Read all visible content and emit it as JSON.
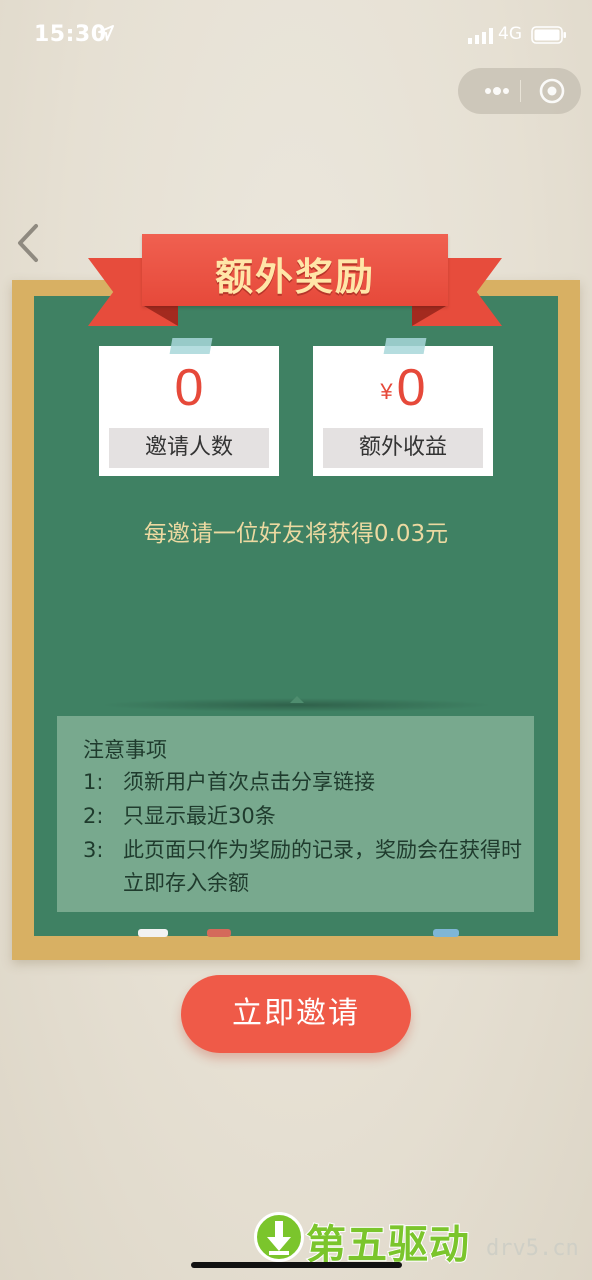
{
  "status_bar": {
    "time": "15:30",
    "network": "4G"
  },
  "banner": {
    "title": "额外奖励"
  },
  "stats": [
    {
      "value": "0",
      "label": "邀请人数"
    },
    {
      "currency": "¥",
      "value": "0",
      "label": "额外收益"
    }
  ],
  "reward_text": "每邀请一位好友将获得0.03元",
  "notes": {
    "title": "注意事项",
    "items": [
      {
        "num": "1:",
        "text": "须新用户首次点击分享链接"
      },
      {
        "num": "2:",
        "text": "只显示最近30条"
      },
      {
        "num": "3:",
        "text": "此页面只作为奖励的记录，奖励会在获得时立即存入余额"
      }
    ]
  },
  "invite_button": {
    "label": "立即邀请"
  },
  "watermark": {
    "brand": "第五驱动",
    "url": "drv5.cn"
  },
  "colors": {
    "board_green": "#3f8163",
    "frame_gold": "#d8b063",
    "accent_red": "#ef5a48",
    "value_red": "#e6493a",
    "chalk_yellow": "#ecd9a1"
  }
}
